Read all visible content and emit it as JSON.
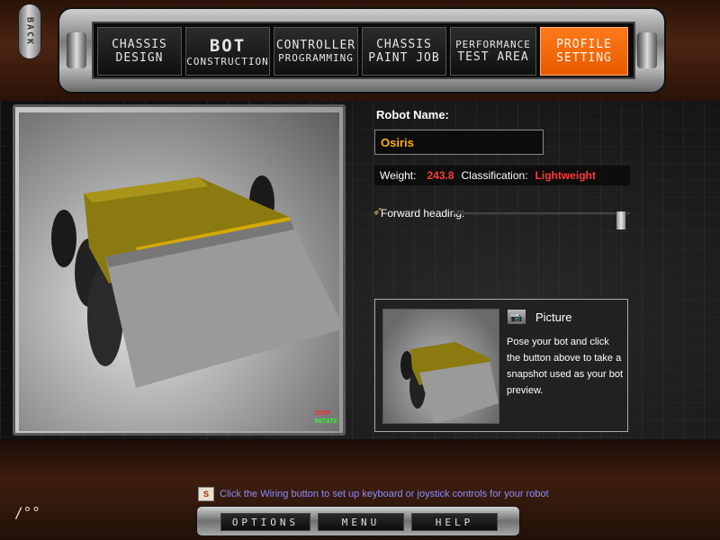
{
  "nav": {
    "back_label": "BACK",
    "tabs": [
      {
        "line1": "CHASSIS",
        "line2": "DESIGN",
        "active": false
      },
      {
        "line1": "BOT",
        "line2": "CONSTRUCTION",
        "active": false
      },
      {
        "line1": "CONTROLLER",
        "line2": "PROGRAMMING",
        "active": false
      },
      {
        "line1": "CHASSIS",
        "line2": "PAINT JOB",
        "active": false
      },
      {
        "line1": "PERFORMANCE",
        "line2": "TEST AREA",
        "active": false
      },
      {
        "line1": "PROFILE",
        "line2": "SETTING",
        "active": true
      }
    ]
  },
  "viewport": {
    "zoom_label": "ZOOM",
    "rotate_label": "ROTATE"
  },
  "profile": {
    "robot_name_label": "Robot Name:",
    "robot_name_value": "Osiris",
    "weight_label": "Weight:",
    "weight_value": "243.8",
    "classification_label": "Classification:",
    "classification_value": "Lightweight",
    "forward_heading_label": "Forward heading:"
  },
  "picture": {
    "label": "Picture",
    "description": "Pose your bot and click the button above to take a snapshot used as your bot preview.",
    "camera_icon": "camera-icon"
  },
  "hint": {
    "text": "Click the Wiring button to set up keyboard or joystick controls for your robot",
    "icon": "wiring-hint-icon"
  },
  "bottom_nav": {
    "options_label": "OPTIONS",
    "menu_label": "MENU",
    "help_label": "HELP"
  },
  "colors": {
    "accent_orange": "#ff7a1a",
    "name_yellow": "#ffb000",
    "value_red": "#ff3a3a",
    "link_blue": "#8c8cff"
  }
}
